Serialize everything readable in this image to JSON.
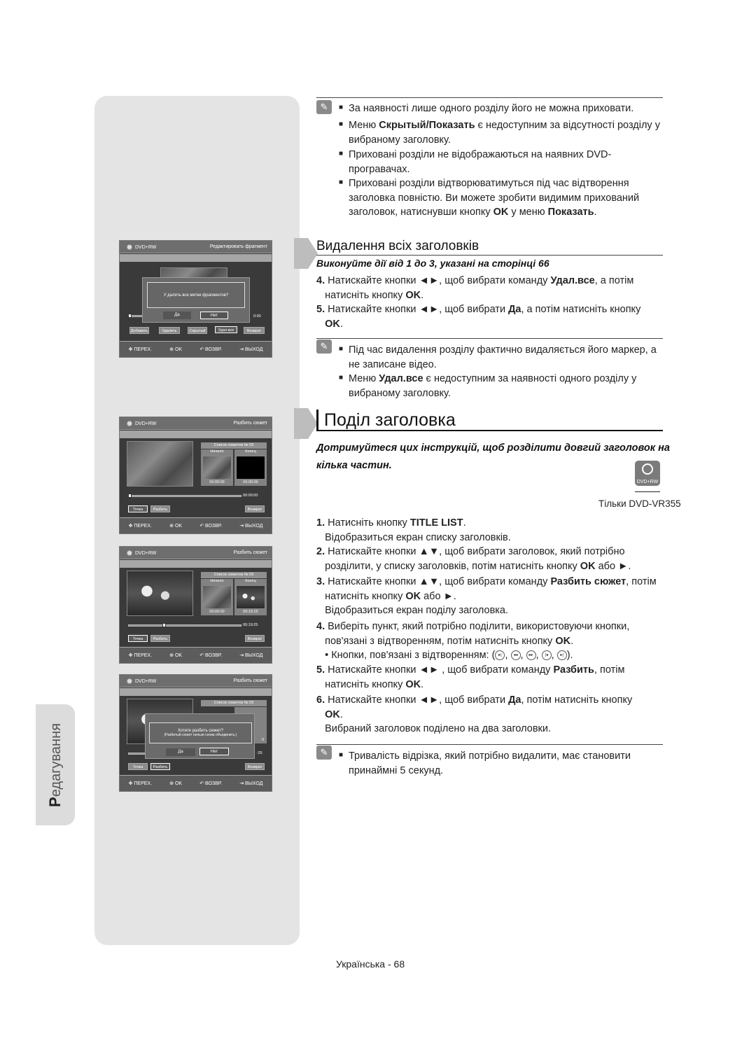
{
  "side_tab": {
    "label": "Редагування"
  },
  "screens": {
    "delete_all": {
      "disc_label": "DVD+RW",
      "title": "Редактировать фрагмент",
      "dialog_message": "У далить все метки фрагментов?",
      "dialog_yes": "Да",
      "dialog_no": "Нет",
      "dialog_selected": "Нет",
      "timecode": "0:00",
      "buttons": [
        "Добавить",
        "Удалить",
        "Скрытый",
        "Удал.все",
        "Возврат"
      ],
      "selected_button": "Удал.все"
    },
    "split_1": {
      "disc_label": "DVD+RW",
      "title": "Разбить сюжет",
      "list_title": "Список сюжетов № 03",
      "start_label": "Начало",
      "end_label": "Конец",
      "start_time": "00:00:00",
      "end_time": "00:00:00",
      "position_time": "00:00:00",
      "progress": 0.0,
      "buttons": [
        "Точка",
        "Разбить",
        "Возврат"
      ],
      "selected_button": "Точка"
    },
    "split_2": {
      "disc_label": "DVD+RW",
      "title": "Разбить сюжет",
      "list_title": "Список сюжетов №  03",
      "start_label": "Начало",
      "end_label": "Конец",
      "start_time": "00:00:00",
      "end_time": "00:19:25",
      "position_time": "00:19:25",
      "progress": 0.3,
      "buttons": [
        "Точка",
        "Разбить",
        "Возврат"
      ],
      "selected_button": "Точка"
    },
    "split_3": {
      "disc_label": "DVD+RW",
      "title": "Разбить сюжет",
      "list_title": "Список сюжетов №  03",
      "dialog_message": "Хотите разбить сюжет?",
      "dialog_message2": "(Разбитый сюжет нельзя снова объединить.)",
      "dialog_yes": "Да",
      "dialog_no": "Нет",
      "dialog_selected": "Нет",
      "timecode": ":25",
      "end_fragment": "0",
      "buttons": [
        "Точка",
        "Разбить",
        "Возврат"
      ],
      "selected_button": "Разбить"
    },
    "footer": {
      "move": "ПЕРЕХ.",
      "ok": "OK",
      "back": "ВОЗВР.",
      "exit": "ВЫХОД"
    }
  },
  "notes_top": [
    {
      "text": "За наявності лише одного розділу його не можна приховати."
    },
    {
      "pre": "Меню ",
      "bold": "Скрытый/Показать",
      "post": " є недоступним за відсутності розділу у",
      "line2": "вибраному заголовку."
    },
    {
      "line1": "Приховані розділи не відображаються на наявних DVD-",
      "line2": "програвачах."
    },
    {
      "line1": "Приховані розділи відтворюватимуться під час відтворення",
      "line2": "заголовка повністю. Ви можете зробити видимим прихований",
      "line3_pre": "заголовок, натиснувши кнопку ",
      "line3_b1": "OK",
      "line3_mid": " у меню ",
      "line3_b2": "Показать",
      "line3_post": "."
    }
  ],
  "section_delete": {
    "title": "Видалення всіх заголовків",
    "subtitle": "Виконуйте дії від 1 до 3, указані на сторінці 66",
    "steps": [
      {
        "num": "4.",
        "pre": " Натискайте кнопки ◄►, щоб вибрати команду ",
        "bold": "Удал.все",
        "post": ", а потім",
        "line2_pre": "натисніть кнопку ",
        "line2_bold": "OK",
        "line2_post": "."
      },
      {
        "num": "5.",
        "pre": " Натискайте кнопки ◄►, щоб вибрати ",
        "bold": "Да",
        "post": ", а потім натисніть кнопку",
        "line2_pre": "",
        "line2_bold": "OK",
        "line2_post": "."
      }
    ],
    "notes": [
      {
        "line1": "Під час видалення розділу фактично видаляється його маркер, а",
        "line2": "не записане відео."
      },
      {
        "pre": "Меню ",
        "bold": "Удал.все",
        "post": " є недоступним за наявності одного розділу у",
        "line2": "вибраному заголовку."
      }
    ]
  },
  "section_split": {
    "title": "Поділ заголовка",
    "subtitle_line1": "Дотримуйтеся цих інструкцій, щоб розділити довгий заголовок на",
    "subtitle_line2": "кілька частин.",
    "badge": "DVD+RW",
    "model_note": "Тільки DVD-VR355",
    "steps": [
      {
        "num": "1.",
        "pre": " Натисніть кнопку ",
        "bold": "TITLE LIST",
        "post": ".",
        "extra": "Відобразиться екран списку заголовків."
      },
      {
        "num": "2.",
        "line1": " Натискайте кнопки ▲▼, щоб вибрати заголовок, який потрібно",
        "line2_pre": "розділити, у списку заголовків, потім натисніть кнопку ",
        "line2_bold": "OK",
        "line2_post": " або ►."
      },
      {
        "num": "3.",
        "pre": " Натискайте кнопки ▲▼, щоб вибрати команду ",
        "bold": "Разбить сюжет",
        "post": ", потім",
        "line2_pre": "натисніть кнопку ",
        "line2_bold": "OK",
        "line2_post": " або ►.",
        "extra": "Відобразиться екран поділу заголовка."
      },
      {
        "num": "4.",
        "line1": " Виберіть пункт, який потрібно поділити, використовуючи кнопки,",
        "line2_pre": "пов'язані з відтворенням, потім натисніть кнопку ",
        "line2_bold": "OK",
        "line2_post": ".",
        "extra_pre": "• Кнопки, пов'язані з відтворенням: (",
        "extra_post": ")."
      },
      {
        "num": "5.",
        "pre": " Натискайте кнопки ◄► , щоб вибрати команду ",
        "bold": "Разбить",
        "post": ", потім",
        "line2_pre": "натисніть кнопку ",
        "line2_bold": "OK",
        "line2_post": "."
      },
      {
        "num": "6.",
        "pre": " Натискайте кнопки ◄►, щоб вибрати ",
        "bold": "Да",
        "post": ", потім натисніть кнопку",
        "line2_pre": "",
        "line2_bold": "OK",
        "line2_post": ".",
        "extra": "Вибраний заголовок поділено на два заголовки."
      }
    ],
    "playback_buttons": [
      "step-icon",
      "rewind-icon",
      "fast-forward-icon",
      "skip-back-icon",
      "skip-forward-icon"
    ],
    "note": {
      "line1": "Тривалість відрізка, який потрібно видалити, має становити",
      "line2": "принаймні 5 секунд."
    }
  },
  "footer": {
    "page_label": "Українська - 68"
  }
}
